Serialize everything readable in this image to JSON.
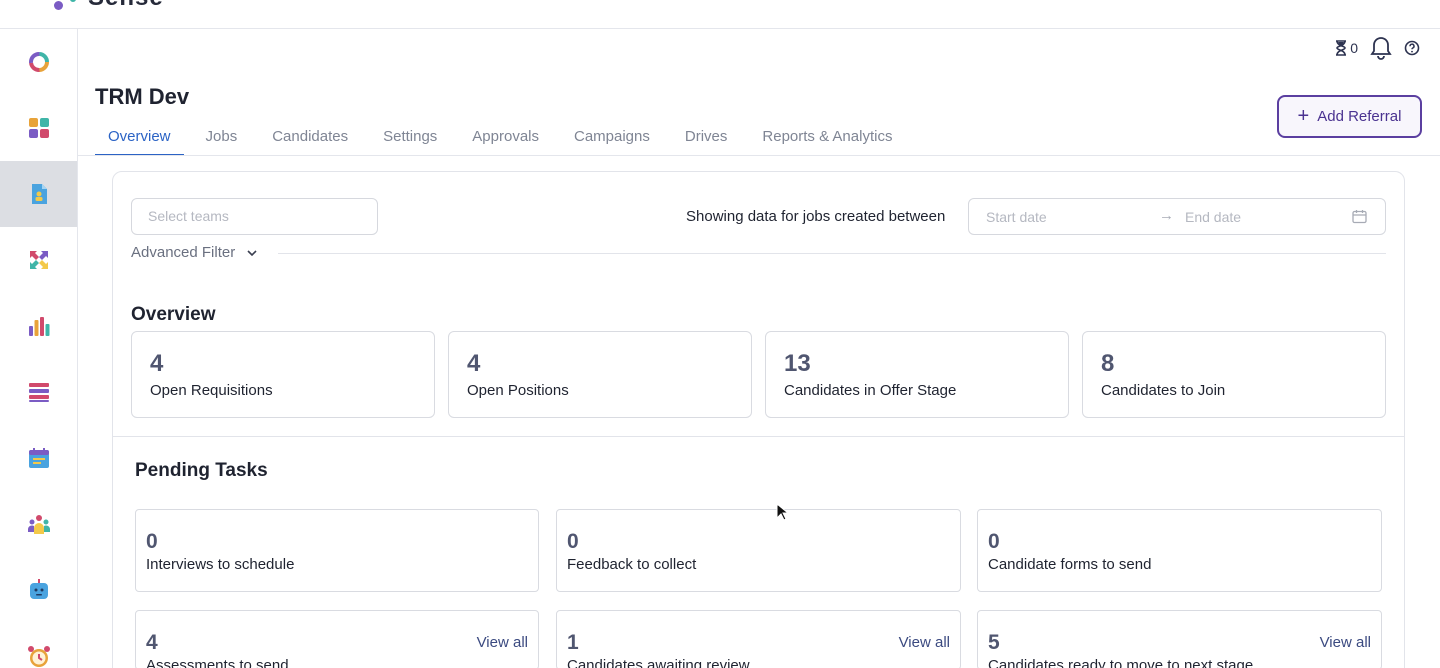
{
  "header": {
    "brand": "Sense",
    "hourglass_count": "0"
  },
  "page": {
    "title": "TRM Dev",
    "add_referral_label": "Add Referral"
  },
  "tabs": [
    {
      "label": "Overview",
      "active": true
    },
    {
      "label": "Jobs"
    },
    {
      "label": "Candidates"
    },
    {
      "label": "Settings"
    },
    {
      "label": "Approvals"
    },
    {
      "label": "Campaigns"
    },
    {
      "label": "Drives"
    },
    {
      "label": "Reports & Analytics"
    }
  ],
  "filters": {
    "teams_placeholder": "Select teams",
    "showing_text": "Showing data for jobs created between",
    "start_placeholder": "Start date",
    "end_placeholder": "End date",
    "advanced_filter": "Advanced Filter"
  },
  "overview": {
    "title": "Overview",
    "stats": [
      {
        "value": "4",
        "label": "Open Requisitions"
      },
      {
        "value": "4",
        "label": "Open Positions"
      },
      {
        "value": "13",
        "label": "Candidates in Offer Stage"
      },
      {
        "value": "8",
        "label": "Candidates to Join"
      }
    ]
  },
  "pending": {
    "title": "Pending Tasks",
    "view_all": "View all",
    "tasks": [
      {
        "value": "0",
        "label": "Interviews to schedule"
      },
      {
        "value": "0",
        "label": "Feedback to collect"
      },
      {
        "value": "0",
        "label": "Candidate forms to send"
      },
      {
        "value": "4",
        "label": "Assessments to send"
      },
      {
        "value": "1",
        "label": "Candidates awaiting review"
      },
      {
        "value": "5",
        "label": "Candidates ready to move to next stage"
      }
    ]
  },
  "colors": {
    "accent": "#2b63c5",
    "brand_purple": "#5b3fa0",
    "sidebar_active": "#dcdee3"
  },
  "sidebar_icons": [
    "ring-logo-icon",
    "dashboard-icon",
    "referral-doc-icon",
    "transfer-arrows-icon",
    "bar-chart-icon",
    "list-icon",
    "calendar-icon",
    "team-icon",
    "bot-icon",
    "alarm-icon"
  ]
}
